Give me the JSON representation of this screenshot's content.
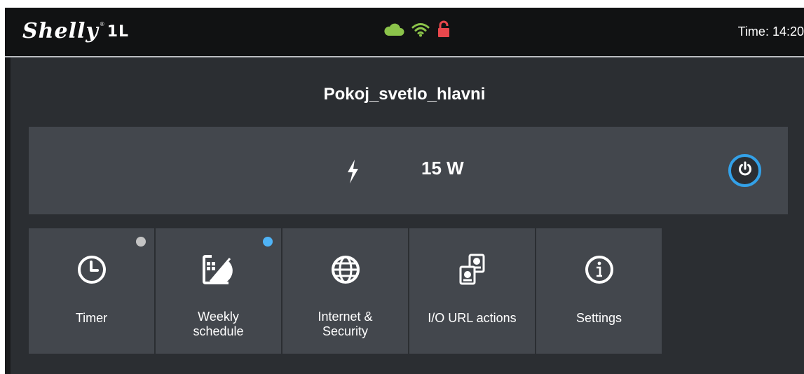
{
  "header": {
    "logo_text": "Shelly",
    "logo_model": "1L",
    "time_text": "Time: 14:20",
    "status_icons": [
      {
        "name": "cloud-icon",
        "color": "#8bc34a"
      },
      {
        "name": "wifi-icon",
        "color": "#8bc34a"
      },
      {
        "name": "unlocked-icon",
        "color": "#e8474c"
      }
    ]
  },
  "device": {
    "name": "Pokoj_svetlo_hlavni"
  },
  "power": {
    "value": "15 W",
    "icon": "lightning-bolt-icon",
    "toggle_icon": "power-icon",
    "toggle_color": "#33a1e8"
  },
  "tiles": [
    {
      "label": "Timer",
      "icon": "clock-icon",
      "indicator": "#c4c4c4"
    },
    {
      "label": "Weekly\nschedule",
      "icon": "calendar-schedule-icon",
      "indicator": "#4fb3f6"
    },
    {
      "label": "Internet &\nSecurity",
      "icon": "globe-icon",
      "indicator": null
    },
    {
      "label": "I/O URL actions",
      "icon": "io-url-actions-icon",
      "indicator": null
    },
    {
      "label": "Settings",
      "icon": "info-icon",
      "indicator": null
    }
  ]
}
